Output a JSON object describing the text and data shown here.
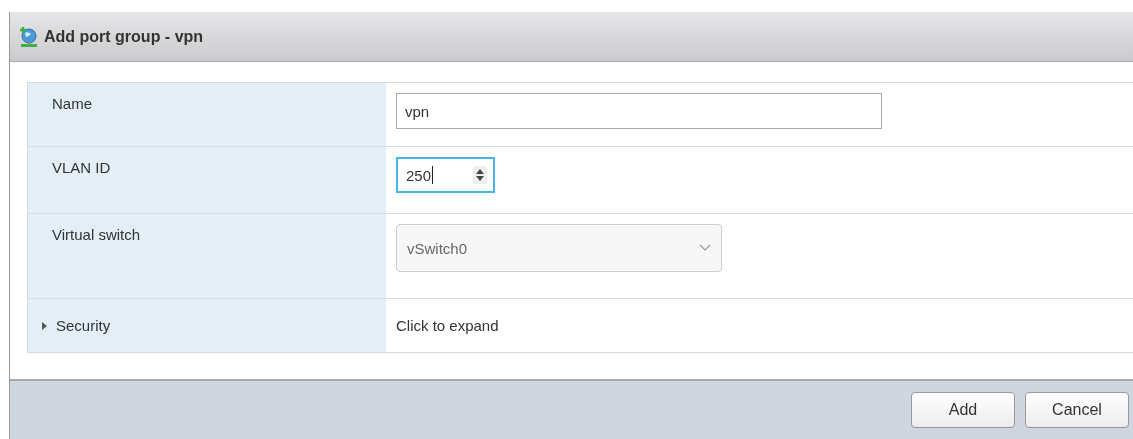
{
  "dialog": {
    "title": "Add port group - vpn"
  },
  "rows": [
    {
      "kind": "text",
      "label": "Name",
      "value": "vpn"
    },
    {
      "kind": "number",
      "label": "VLAN ID",
      "value": "250",
      "focused": true
    },
    {
      "kind": "select",
      "label": "Virtual switch",
      "value": "vSwitch0"
    },
    {
      "kind": "expander",
      "label": "Security",
      "value": "Click to expand",
      "expanded": false
    }
  ],
  "buttons": [
    "Add",
    "Cancel"
  ]
}
